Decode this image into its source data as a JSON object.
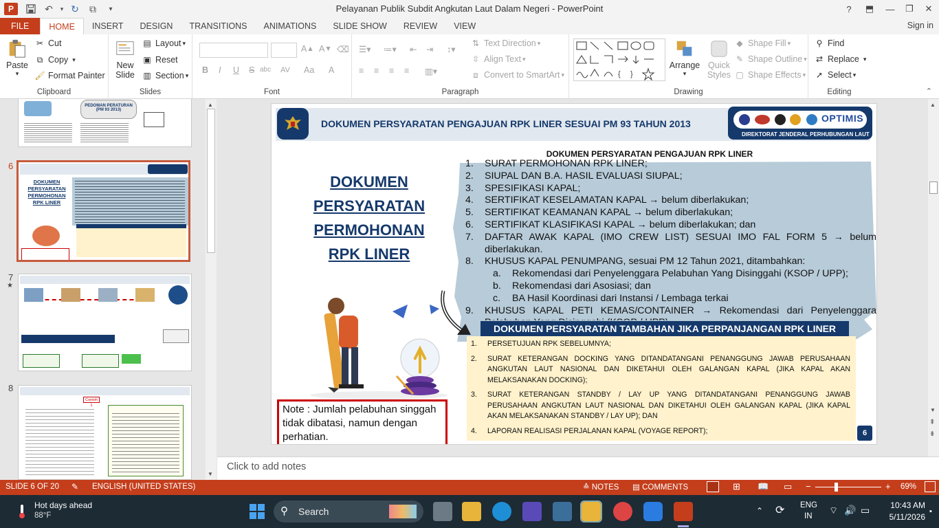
{
  "window": {
    "title": "Pelayanan Publik Subdit Angkutan Laut Dalam Negeri - PowerPoint",
    "app_badge": "P",
    "help": "?",
    "minimize": "—",
    "restore": "❐",
    "close": "✕"
  },
  "tabs": [
    "FILE",
    "HOME",
    "INSERT",
    "DESIGN",
    "TRANSITIONS",
    "ANIMATIONS",
    "SLIDE SHOW",
    "REVIEW",
    "VIEW"
  ],
  "signin": "Sign in",
  "ribbon": {
    "clipboard": {
      "label": "Clipboard",
      "paste": "Paste",
      "cut": "Cut",
      "copy": "Copy",
      "format_painter": "Format Painter"
    },
    "slides": {
      "label": "Slides",
      "new_slide_1": "New",
      "new_slide_2": "Slide",
      "layout": "Layout",
      "reset": "Reset",
      "section": "Section"
    },
    "font": {
      "label": "Font",
      "bold": "B",
      "italic": "I",
      "underline": "U",
      "strike": "S",
      "shadow": "abc",
      "spacing": "AV",
      "case": "Aa",
      "color": "A"
    },
    "paragraph": {
      "label": "Paragraph",
      "text_direction": "Text Direction",
      "align_text": "Align Text",
      "smartart": "Convert to SmartArt"
    },
    "drawing": {
      "label": "Drawing",
      "arrange": "Arrange",
      "quick_styles_1": "Quick",
      "quick_styles_2": "Styles",
      "shape_fill": "Shape Fill",
      "shape_outline": "Shape Outline",
      "shape_effects": "Shape Effects"
    },
    "editing": {
      "label": "Editing",
      "find": "Find",
      "replace": "Replace",
      "select": "Select"
    }
  },
  "thumbnails": {
    "slide5_lines": [
      "PEDOMAN PERATURAN",
      "(PM 93 2013)"
    ],
    "slide6": {
      "num": "6",
      "title_lines": [
        "DOKUMEN",
        "PERSYARATAN",
        "PERMOHONAN",
        "RPK LINER"
      ]
    },
    "slide7": {
      "num": "7",
      "star": "★"
    },
    "slide8": {
      "num": "8",
      "tag": "Contoh 1"
    }
  },
  "slide": {
    "header_title": "DOKUMEN PERSYARATAN PENGAJUAN RPK LINER SESUAI PM 93 TAHUN 2013",
    "logo_text": "OPTIMIS",
    "directorate": "DIREKTORAT JENDERAL PERHUBUNGAN LAUT",
    "big_title": [
      "DOKUMEN",
      "PERSYARATAN",
      "PERMOHONAN",
      "RPK LINER"
    ],
    "list_heading": "DOKUMEN PERSYARATAN PENGAJUAN RPK LINER",
    "list_items": [
      {
        "n": "1.",
        "t": "SURAT PERMOHONAN RPK LINER;"
      },
      {
        "n": "2.",
        "t": "SIUPAL DAN B.A. HASIL EVALUASI SIUPAL;"
      },
      {
        "n": "3.",
        "t": "SPESIFIKASI KAPAL;"
      },
      {
        "n": "4.",
        "t": "SERTIFIKAT KESELAMATAN KAPAL → belum diberlakukan;"
      },
      {
        "n": "5.",
        "t": "SERTIFIKAT KEAMANAN KAPAL → belum diberlakukan;"
      },
      {
        "n": "6.",
        "t": "SERTIFIKAT KLASIFIKASI KAPAL → belum diberlakukan; dan"
      },
      {
        "n": "7.",
        "t": "DAFTAR AWAK KAPAL (IMO CREW LIST) SESUAI IMO FAL FORM 5 → belum diberlakukan."
      },
      {
        "n": "8.",
        "t": "KHUSUS KAPAL PENUMPANG, sesuai PM 12 Tahun 2021, ditambahkan:"
      },
      {
        "n": "a.",
        "t": "Rekomendasi dari Penyelenggara Pelabuhan Yang Disinggahi (KSOP / UPP);"
      },
      {
        "n": "b.",
        "t": "Rekomendasi dari Asosiasi; dan"
      },
      {
        "n": "c.",
        "t": "BA Hasil Koordinasi dari Instansi / Lembaga terkai"
      },
      {
        "n": "9.",
        "t": "KHUSUS KAPAL PETI KEMAS/CONTAINER → Rekomendasi dari Penyelenggara Pelabuhan Yang Disinggahi (KSOP / UPP)"
      }
    ],
    "extra_heading": "DOKUMEN PERSYARATAN TAMBAHAN JIKA PERPANJANGAN  RPK LINER",
    "extra_items": [
      {
        "n": "1.",
        "t": "PERSETUJUAN RPK SEBELUMNYA;"
      },
      {
        "n": "2.",
        "t": "SURAT KETERANGAN DOCKING YANG DITANDATANGANI PENANGGUNG JAWAB PERUSAHAAN ANGKUTAN LAUT NASIONAL DAN DIKETAHUI OLEH GALANGAN KAPAL (JIKA KAPAL AKAN MELAKSANAKAN DOCKING);"
      },
      {
        "n": "3.",
        "t": "SURAT KETERANGAN STANDBY / LAY UP YANG DITANDATANGANI PENANGGUNG JAWAB PERUSAHAAN ANGKUTAN LAUT NASIONAL DAN DIKETAHUI OLEH GALANGAN KAPAL  (JIKA KAPAL AKAN MELAKSANAKAN STANDBY / LAY UP); DAN"
      },
      {
        "n": "4.",
        "t": "LAPORAN REALISASI PERJALANAN KAPAL (VOYAGE REPORT);"
      }
    ],
    "note": "Note : Jumlah pelabuhan singgah tidak dibatasi, namun dengan perhatian.",
    "page_number": "6"
  },
  "notes_placeholder": "Click to add notes",
  "status": {
    "slide_of": "SLIDE 6 OF 20",
    "language": "ENGLISH (UNITED STATES)",
    "notes": "NOTES",
    "comments": "COMMENTS",
    "zoom": "69%",
    "minus": "−",
    "plus": "+"
  },
  "taskbar": {
    "weather_title": "Hot days ahead",
    "weather_temp": "88°F",
    "search": "Search",
    "lang_1": "ENG",
    "lang_2": "IN",
    "time": "10:43 AM",
    "date": "5/11/2026"
  },
  "colors": {
    "accent": "#c43e1c",
    "slide_header": "#e1e8ef",
    "slide_navy": "#15396b",
    "slide_blue_bg": "#b7cbd9",
    "extra_bg": "#fff2cc"
  }
}
